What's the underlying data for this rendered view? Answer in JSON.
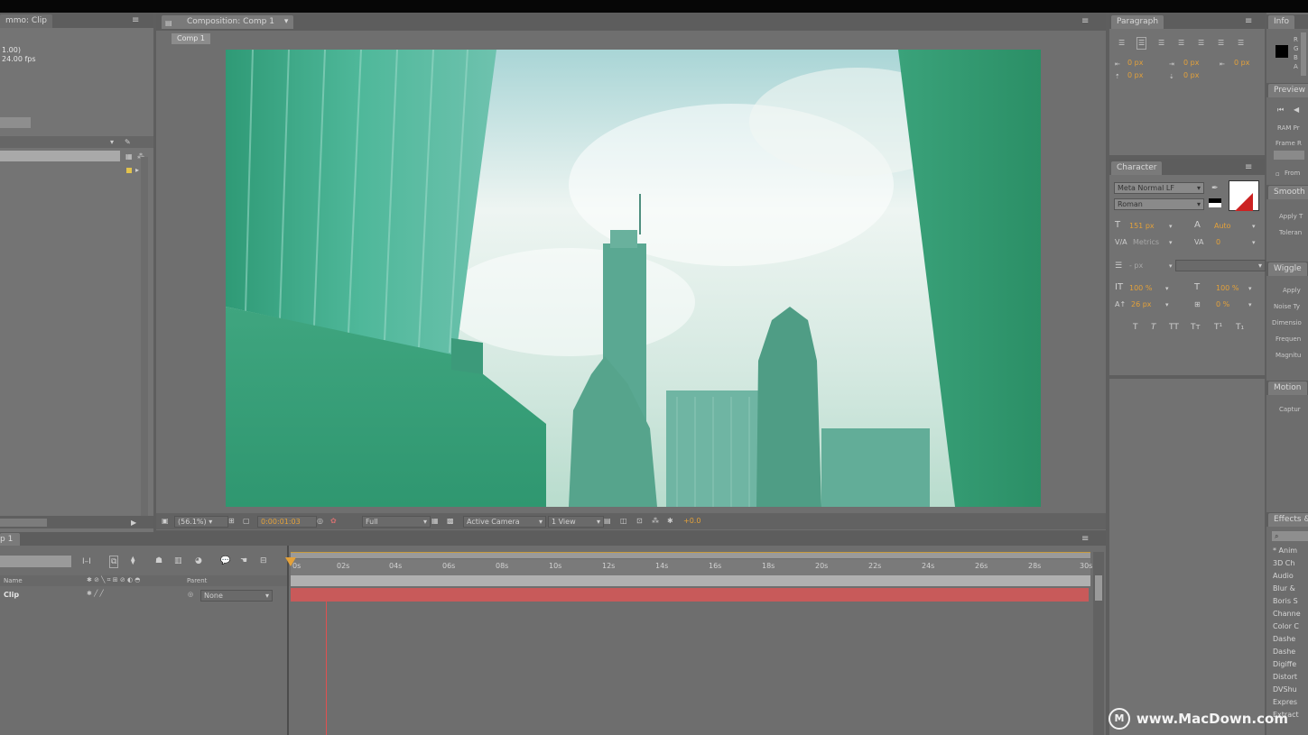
{
  "project": {
    "title_fragment": "mmo: Clip",
    "info_lines": [
      "1.00)",
      "24.00 fps"
    ]
  },
  "composition": {
    "tab": "Composition: Comp 1",
    "subtab": "Comp 1"
  },
  "viewer_toolbar": {
    "zoom": "(56.1%)",
    "timecode": "0:00:01:03",
    "resolution": "Full",
    "camera": "Active Camera",
    "view": "1 View",
    "exposure": "+0.0"
  },
  "timeline": {
    "tab": "p 1",
    "columns": {
      "source_name": "Name",
      "parent": "Parent"
    },
    "layer": {
      "name": "Clip",
      "parent": "None"
    },
    "ruler": [
      "0s",
      "02s",
      "04s",
      "06s",
      "08s",
      "10s",
      "12s",
      "14s",
      "16s",
      "18s",
      "20s",
      "22s",
      "24s",
      "26s",
      "28s",
      "30s"
    ]
  },
  "paragraph": {
    "title": "Paragraph",
    "values": [
      "0 px",
      "0 px",
      "0 px",
      "0 px",
      "0 px"
    ]
  },
  "character": {
    "title": "Character",
    "font": "Meta Normal LF",
    "style": "Roman",
    "size": "151 px",
    "leading": "Auto",
    "kerning": "Metrics",
    "tracking": "0",
    "stroke": "- px",
    "vscale": "100 %",
    "hscale": "100 %",
    "baseline": "26 px",
    "tsume": "0 %"
  },
  "right_column": {
    "info_title": "Info",
    "info_channels": [
      "R",
      "G",
      "B",
      "A"
    ],
    "preview_title": "Preview",
    "preview_items": [
      "RAM Pr",
      "Frame R",
      "From"
    ],
    "smoother_title": "Smooth",
    "smoother_items": [
      "Apply T",
      "Toleran"
    ],
    "wiggler_title": "Wiggle",
    "wiggler_items": [
      "Apply",
      "Noise Ty",
      "Dimensio",
      "Frequen",
      "Magnitu"
    ],
    "motion_title": "Motion",
    "motion_items": [
      "Captur"
    ],
    "effects_title": "Effects &",
    "effects_items": [
      "* Anim",
      "3D Ch",
      "Audio",
      "Blur &",
      "Boris S",
      "Channe",
      "Color C",
      "Dashe",
      "Dashe",
      "Digiffe",
      "Distort",
      "DVShu",
      "Expres",
      "Extract"
    ]
  },
  "watermark": "www.MacDown.com",
  "colors": {
    "accent_orange": "#e3a13a",
    "layer_bar": "#c85a5a",
    "panel_bg": "#747474",
    "playhead": "#e05050"
  }
}
